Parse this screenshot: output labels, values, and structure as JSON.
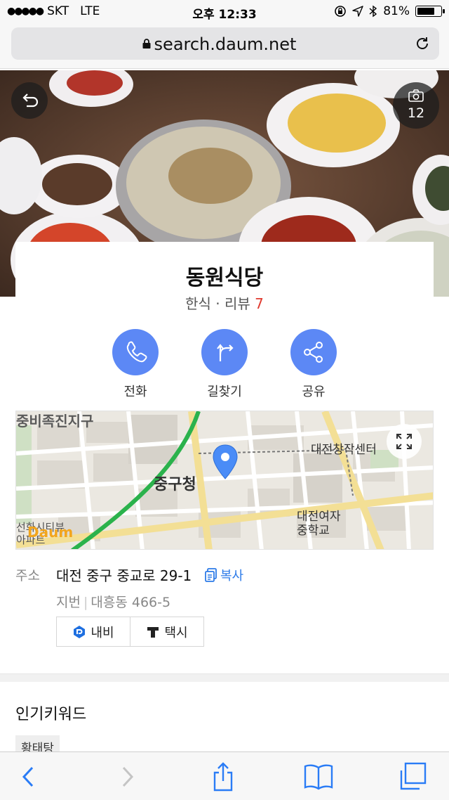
{
  "status_bar": {
    "carrier": "SKT",
    "network": "LTE",
    "time": "오후 12:33",
    "battery": "81%",
    "battery_level": 0.81
  },
  "browser": {
    "url": "search.daum.net"
  },
  "hero": {
    "photo_count": "12"
  },
  "place": {
    "name": "동원식당",
    "category": "한식",
    "separator": "·",
    "review_label": "리뷰",
    "review_count": "7"
  },
  "actions": [
    {
      "label": "전화",
      "icon": "phone-icon"
    },
    {
      "label": "길찾기",
      "icon": "directions-icon"
    },
    {
      "label": "공유",
      "icon": "share-icon"
    }
  ],
  "map": {
    "labels": {
      "district": "중구청",
      "center": "대전창작센터",
      "school": "대전여자\n중학교",
      "top_left": "중비족진지구",
      "bottom_left": "선화시티뷰\n아파트"
    },
    "logo": "Daum"
  },
  "address": {
    "label": "주소",
    "road": "대전 중구 중교로 29-1",
    "copy_label": "복사",
    "jibun_label": "지번",
    "jibun": "대흥동 466-5"
  },
  "nav_buttons": {
    "navi": "내비",
    "taxi": "택시"
  },
  "popular": {
    "title": "인기키워드",
    "tags": [
      "황태탕"
    ]
  },
  "colors": {
    "accent": "#5c88f5",
    "review_count": "#e03a2f",
    "link": "#2d7be8"
  }
}
